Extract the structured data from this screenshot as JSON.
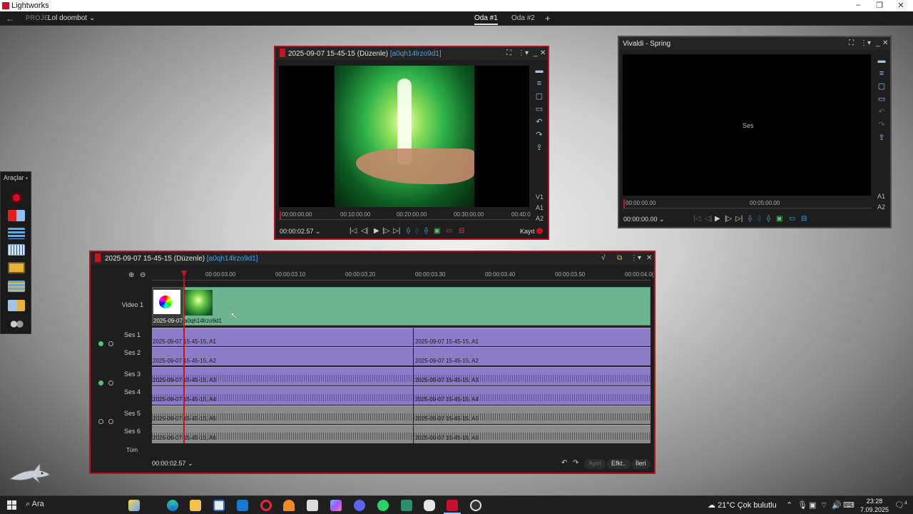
{
  "window": {
    "title": "Lightworks",
    "controls": [
      "–",
      "❐",
      "✕"
    ]
  },
  "project_bar": {
    "back_icon": "←",
    "label": "PROJE",
    "project_name": "Lol doombot ⌄",
    "tabs": [
      "Oda #1",
      "Oda #2"
    ],
    "active_tab": "Oda #1",
    "add_tab": "+"
  },
  "tools_panel": {
    "title": "Araçlar",
    "pin": "📌",
    "tools": [
      "record-tool",
      "import-tool",
      "project-contents-tool",
      "bin-tool",
      "viewer-tool",
      "edit-tool",
      "export-tool",
      "users-tool"
    ]
  },
  "source_viewer": {
    "title": "2025-09-07 15-45-15 (Düzenle)",
    "id": "[a0qh14lrzo9d1]",
    "channels": [
      "V1",
      "A1",
      "A2"
    ],
    "ruler": [
      "00:00:00.00",
      "00:10:00.00",
      "00:20:00.00",
      "00:30:00.00",
      "00:40:0"
    ],
    "timecode": "00:00:02.57 ⌄",
    "record_label": "Kayıt",
    "accent": "#b5131d"
  },
  "vivaldi_viewer": {
    "title": "Vivaldi - Spring",
    "overlay_text": "Ses",
    "channels": [
      "A1",
      "A2"
    ],
    "ruler": [
      "00:00:00.00",
      "00:05:00.00"
    ],
    "timecode": "00:00:00.00 ⌄"
  },
  "timeline": {
    "title": "2025-09-07 15-45-15 (Düzenle)",
    "id": "[a0qh14lrzo9d1]",
    "ruler": [
      "00:00:03.00",
      "00:00:03.10",
      "00:00:03.20",
      "00:00:03.30",
      "00:00:03.40",
      "00:00:03.50",
      "00:00:04.0("
    ],
    "tracks": {
      "video": "Video 1",
      "audio": [
        "Ses 1",
        "Ses 2",
        "Ses 3",
        "Ses 4",
        "Ses 5",
        "Ses 6"
      ],
      "all": "Tüm"
    },
    "video_clips": [
      "2025-09-07",
      "a0qh14lrzo9d1"
    ],
    "audio_clips_left": [
      "2025-09-07 15-45-15, A1",
      "2025-09-07 15-45-15, A2",
      "2025-09-07 15-45-15, A3",
      "2025-09-07 15-45-15, A4",
      "2025-09-07 15-45-15, A5",
      "2025-09-07 15-45-15, A6"
    ],
    "audio_clips_right": [
      "2025-09-07 15-45-15, A1",
      "2025-09-07 15-45-15, A2",
      "2025-09-07 15-45-15, A3",
      "2025-09-07 15-45-15, A4",
      "2025-09-07 15-45-15, A5",
      "2025-09-07 15-45-15, A6"
    ],
    "timecode": "00:00:02.57 ⌄",
    "buttons": {
      "remove": "Ayırl",
      "effects": "Efkt..",
      "next": "İleri"
    },
    "colors": {
      "video_clip": "#6db590",
      "audio_clip": "#8c7bc7",
      "audio_clip_muted": "#8a8a8a",
      "playhead": "#d0101e"
    }
  },
  "taskbar": {
    "search_label": "Ara",
    "weather": "21°C  Çok bulutlu",
    "time": "23:28",
    "date": "7.09.2025",
    "notification_count": "4"
  }
}
